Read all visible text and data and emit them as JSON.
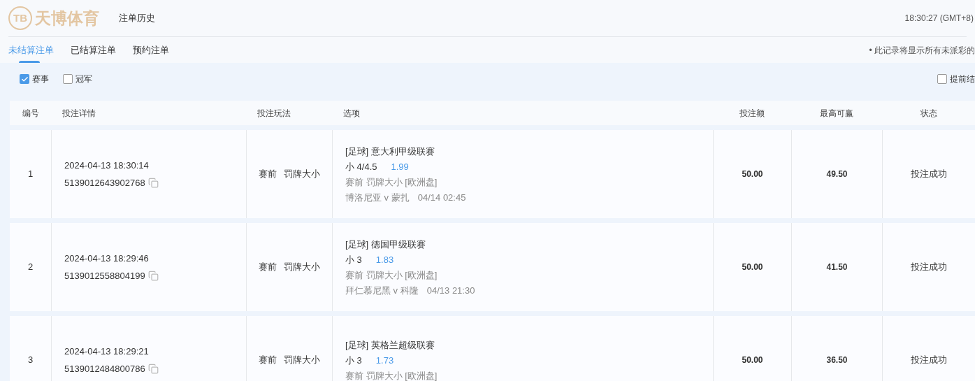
{
  "header": {
    "logo": {
      "mark": "TB",
      "name": "天博体育"
    },
    "title": "注单历史",
    "clock": "18:30:27 (GMT+8)"
  },
  "tabs": [
    {
      "label": "未结算注单",
      "selected": true
    },
    {
      "label": "已结算注单",
      "selected": false
    },
    {
      "label": "预约注单",
      "selected": false
    }
  ],
  "notice": "• 此记录将显示所有未派彩的",
  "filters": [
    {
      "label": "赛事",
      "checked": true
    },
    {
      "label": "冠军",
      "checked": false
    }
  ],
  "cashout_filter": {
    "label": "提前结",
    "checked": false
  },
  "table": {
    "columns": [
      "编号",
      "投注详情",
      "投注玩法",
      "选项",
      "投注额",
      "最高可赢",
      "状态"
    ],
    "rows": [
      {
        "no": "1",
        "time": "2024-04-13 18:30:14",
        "ticket": "5139012643902768",
        "type": [
          "赛前",
          "罚牌大小"
        ],
        "league": "[足球] 意大利甲级联赛",
        "pick": "小 4/4.5",
        "odds": "1.99",
        "market": "赛前 罚牌大小 [欧洲盘]",
        "match": "博洛尼亚 v 蒙扎",
        "kickoff": "04/14 02:45",
        "stake": "50.00",
        "max_win": "49.50",
        "status": "投注成功"
      },
      {
        "no": "2",
        "time": "2024-04-13 18:29:46",
        "ticket": "5139012558804199",
        "type": [
          "赛前",
          "罚牌大小"
        ],
        "league": "[足球] 德国甲级联赛",
        "pick": "小 3",
        "odds": "1.83",
        "market": "赛前 罚牌大小 [欧洲盘]",
        "match": "拜仁慕尼黑 v 科隆",
        "kickoff": "04/13 21:30",
        "stake": "50.00",
        "max_win": "41.50",
        "status": "投注成功"
      },
      {
        "no": "3",
        "time": "2024-04-13 18:29:21",
        "ticket": "5139012484800786",
        "type": [
          "赛前",
          "罚牌大小"
        ],
        "league": "[足球] 英格兰超级联赛",
        "pick": "小 3",
        "odds": "1.73",
        "market": "赛前 罚牌大小 [欧洲盘]",
        "stake": "50.00",
        "max_win": "36.50",
        "status": "投注成功"
      }
    ]
  }
}
